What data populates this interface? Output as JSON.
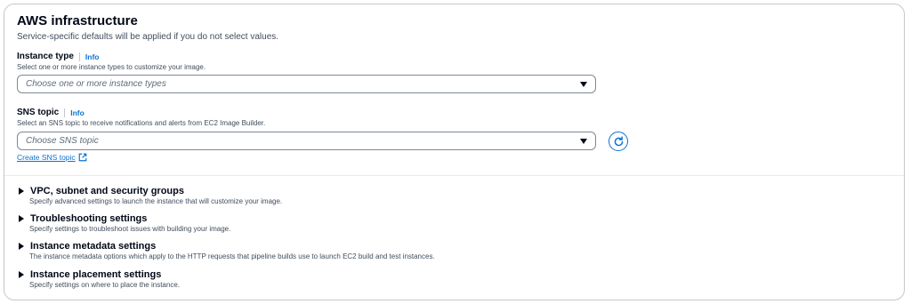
{
  "section": {
    "title": "AWS infrastructure",
    "description": "Service-specific defaults will be applied if you do not select values."
  },
  "instance_type": {
    "label": "Instance type",
    "info": "Info",
    "hint": "Select one or more instance types to customize your image.",
    "placeholder": "Choose one or more instance types"
  },
  "sns_topic": {
    "label": "SNS topic",
    "info": "Info",
    "hint": "Select an SNS topic to receive notifications and alerts from EC2 Image Builder.",
    "placeholder": "Choose SNS topic",
    "create_link": "Create SNS topic"
  },
  "expanders": [
    {
      "title": "VPC, subnet and security groups",
      "description": "Specify advanced settings to launch the instance that will customize your image."
    },
    {
      "title": "Troubleshooting settings",
      "description": "Specify settings to troubleshoot issues with building your image."
    },
    {
      "title": "Instance metadata settings",
      "description": "The instance metadata options which apply to the HTTP requests that pipeline builds use to launch EC2 build and test instances."
    },
    {
      "title": "Instance placement settings",
      "description": "Specify settings on where to place the instance."
    }
  ],
  "colors": {
    "link": "#0972d3",
    "text": "#000716",
    "secondary_text": "#414d5c",
    "border": "#7d8998"
  },
  "icons": {
    "refresh": "refresh-icon",
    "external": "external-link-icon",
    "caret": "caret-down-icon",
    "expand": "caret-right-icon"
  }
}
